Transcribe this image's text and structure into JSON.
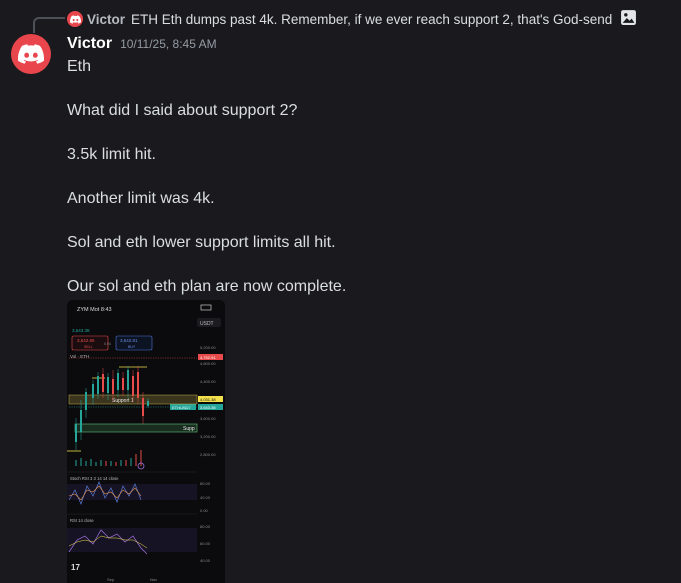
{
  "reply": {
    "author": "Victor",
    "text": "ETH  Eth dumps past 4k.  Remember, if we ever reach support 2, that's God-send",
    "icons": [
      "discord-logo",
      "image-icon"
    ]
  },
  "author": {
    "name": "Victor",
    "timestamp": "10/11/25, 8:45 AM",
    "avatar_color": "#e8464c"
  },
  "message": {
    "lines": [
      "Eth",
      "",
      "What did I said about support 2?",
      "",
      "3.5k limit hit.",
      "",
      "Another limit was 4k.",
      "",
      "Sol and eth lower support limits all hit.",
      "",
      "Our sol and eth plan are now complete."
    ]
  },
  "attachment": {
    "status_bar": "ZYM Mot 8:43",
    "currency": "USDT",
    "symbol_price": "3,643.38",
    "sell_price": "3,642.85",
    "sell_label": "SELL",
    "buy_price": "3,642.81",
    "buy_label": "BUY",
    "spread": "0.04",
    "volume_label": "Vol · ETH",
    "support1_label": "Support 1",
    "support2_label": "Supp",
    "ticker_tag": "ETHUSDT",
    "price_tags": {
      "red": "4,752.91",
      "yellow": "4,031.38",
      "green": "3,643.38"
    },
    "price_axis": [
      "5,200.00",
      "4,800.00",
      "4,400.00",
      "4,000.00",
      "3,600.00",
      "3,200.00",
      "2,800.00"
    ],
    "stoch_label": "Stoch RSI 3 3 14 14 close",
    "stoch_axis": [
      "80.00",
      "40.00",
      "0.00"
    ],
    "rsi_label": "RSI 14 close",
    "rsi_axis": [
      "80.00",
      "60.00",
      "40.00"
    ],
    "time_axis": [
      "Sep",
      "Nov"
    ],
    "colors": {
      "red": "#e84b4b",
      "green": "#26a69a",
      "yellow": "#f2e14c"
    }
  }
}
